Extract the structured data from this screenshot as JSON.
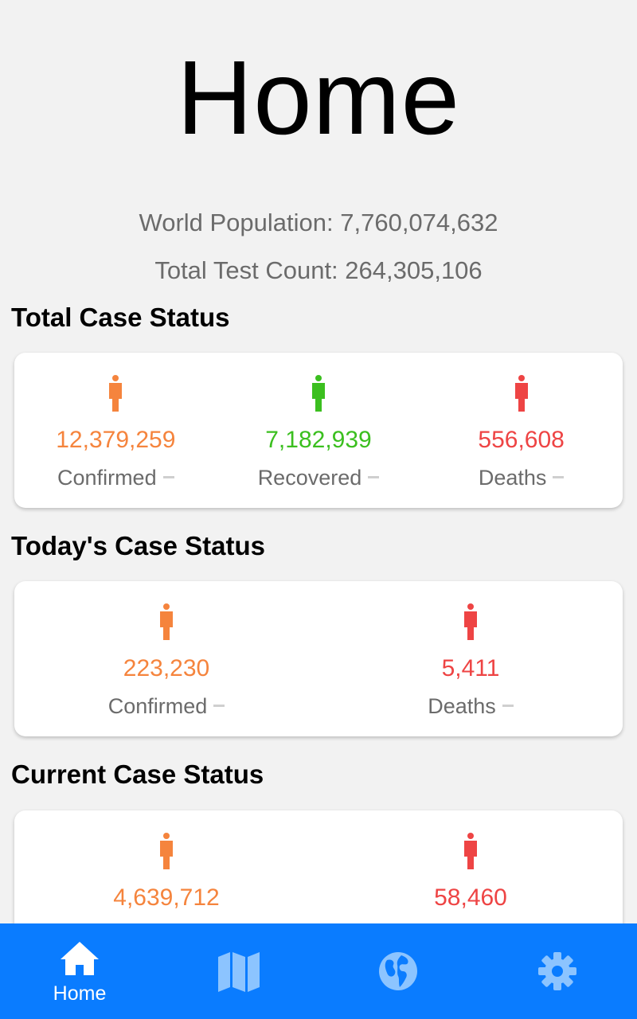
{
  "page": {
    "title": "Home",
    "world_population": "World Population: 7,760,074,632",
    "total_test_count": "Total Test Count: 264,305,106"
  },
  "colors": {
    "confirmed": "#f5843d",
    "recovered": "#3bbf1f",
    "deaths": "#ee4444",
    "nav_background": "#0a7cff",
    "nav_active": "#ffffff",
    "nav_inactive": "#8cc4ff"
  },
  "sections": {
    "total": {
      "heading": "Total Case Status",
      "confirmed": {
        "value": "12,379,259",
        "label": "Confirmed"
      },
      "recovered": {
        "value": "7,182,939",
        "label": "Recovered"
      },
      "deaths": {
        "value": "556,608",
        "label": "Deaths"
      }
    },
    "today": {
      "heading": "Today's Case Status",
      "confirmed": {
        "value": "223,230",
        "label": "Confirmed"
      },
      "deaths": {
        "value": "5,411",
        "label": "Deaths"
      }
    },
    "current": {
      "heading": "Current Case Status",
      "confirmed": {
        "value": "4,639,712"
      },
      "deaths": {
        "value": "58,460"
      }
    }
  },
  "nav": {
    "home": {
      "label": "Home",
      "icon": "home-icon"
    },
    "map": {
      "icon": "map-icon"
    },
    "globe": {
      "icon": "globe-icon"
    },
    "settings": {
      "icon": "gear-icon"
    }
  }
}
